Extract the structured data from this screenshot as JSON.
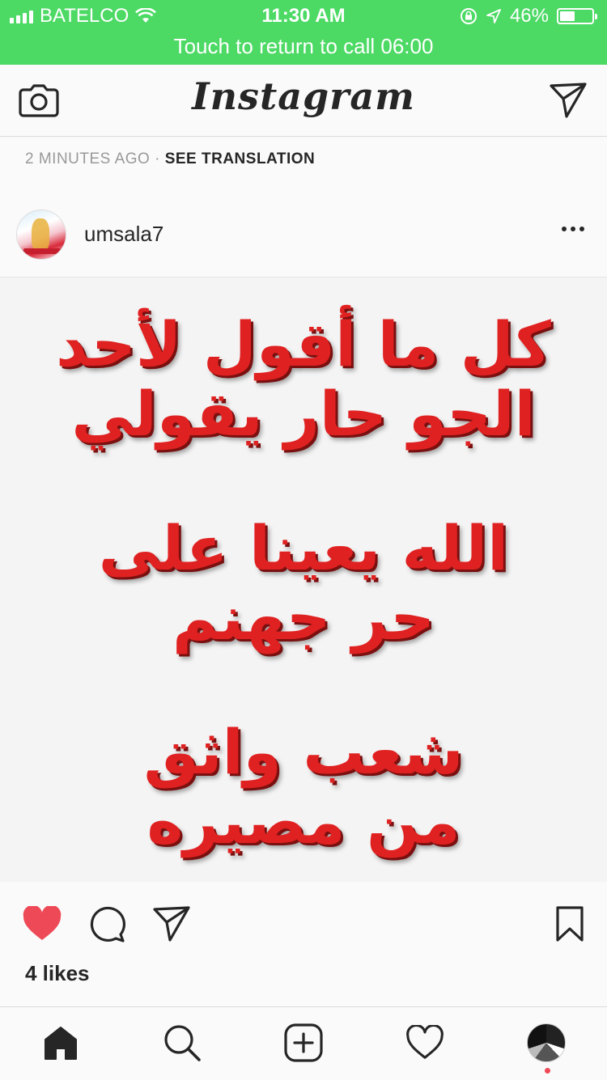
{
  "status_bar": {
    "carrier": "BATELCO",
    "time": "11:30 AM",
    "battery": "46%",
    "battery_level": 0.46,
    "call_banner": "Touch to return to call 06:00",
    "background_color": "#4cd964"
  },
  "nav": {
    "logo": "Instagram",
    "left_icon": "camera-icon",
    "right_icon": "direct-message-icon"
  },
  "previous_post": {
    "timestamp": "2 MINUTES AGO",
    "separator": "·",
    "translation_link": "SEE TRANSLATION"
  },
  "post": {
    "username": "umsala7",
    "more_icon": "more-options-icon",
    "image_text": [
      "كل ما أقول لأحد",
      "الجو حار يقولي",
      "الله يعينا على",
      "حر جهنم",
      "شعب واثق",
      "من مصيره"
    ],
    "image_text_color": "#e02121",
    "actions": [
      "heart-icon",
      "comment-icon",
      "share-icon",
      "bookmark-icon"
    ],
    "liked": true,
    "like_color": "#ed4956",
    "likes": "4 likes"
  },
  "tab_bar": {
    "items": [
      "home-icon",
      "search-icon",
      "new-post-icon",
      "activity-icon",
      "profile-icon"
    ],
    "active": "home-icon"
  }
}
